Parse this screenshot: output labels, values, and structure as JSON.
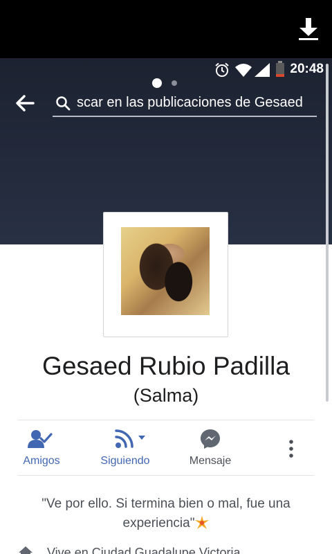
{
  "status_bar": {
    "time": "20:48",
    "icons": [
      "alarm-icon",
      "wifi-icon",
      "signal-icon",
      "battery-low-icon"
    ]
  },
  "top_bar": {
    "icon": "download-icon"
  },
  "cover": {
    "pager": {
      "dot_count": 2,
      "active_index": 0
    }
  },
  "search": {
    "icon": "search-icon",
    "text": "scar en las publicaciones de Gesaed",
    "back_icon": "back-arrow-icon"
  },
  "profile": {
    "name": "Gesaed Rubio Padilla",
    "nickname": "(Salma)"
  },
  "actions": [
    {
      "id": "friends",
      "label": "Amigos",
      "icon": "friend-check-icon"
    },
    {
      "id": "following",
      "label": "Siguiendo",
      "icon": "rss-dropdown-icon"
    },
    {
      "id": "message",
      "label": "Mensaje",
      "icon": "messenger-icon"
    },
    {
      "id": "more",
      "label": "",
      "icon": "more-vertical-icon"
    }
  ],
  "bio": {
    "text": "\"Ve por ello. Si termina bien o mal, fue una experiencia\"",
    "emoji": "sparkle-star-icon"
  },
  "intro": {
    "lives_in": "Vive en Ciudad Guadalupe Victoria"
  },
  "colors": {
    "accent": "#4267b2",
    "cover_dark": "#1c2230",
    "text_dark": "#1d1e20",
    "text_muted": "#4b4f56",
    "messenger_gray": "#606770"
  }
}
